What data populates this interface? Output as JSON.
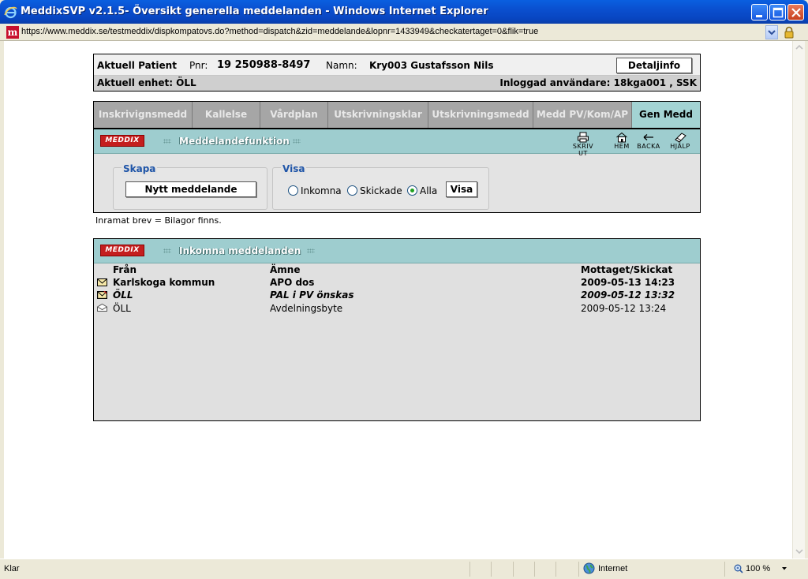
{
  "window": {
    "title": "MeddixSVP v2.1.5- Översikt generella meddelanden - Windows Internet Explorer",
    "url": "https://www.meddix.se/testmeddix/dispkompatovs.do?method=dispatch&zid=meddelande&lopnr=1433949&checkatertaget=0&flik=true"
  },
  "patient": {
    "heading": "Aktuell Patient",
    "pnr_label": "Pnr:",
    "pnr_value": "19 250988-8497",
    "name_label": "Namn:",
    "name_value": "Kry003 Gustafsson Nils",
    "detail_button": "Detaljinfo",
    "unit_text": "Aktuell enhet: ÖLL",
    "user_text": "Inloggad användare: 18kga001 , SSK"
  },
  "tabs": [
    {
      "label": "Inskrivignsmedd"
    },
    {
      "label": "Kallelse"
    },
    {
      "label": "Vårdplan"
    },
    {
      "label": "Utskrivningsklar"
    },
    {
      "label": "Utskrivningsmedd"
    },
    {
      "label": "Medd PV/Kom/AP"
    },
    {
      "label": "Gen Medd"
    }
  ],
  "function_panel": {
    "logo": "MEDDIX",
    "title": "Meddelandefunktion",
    "tools": {
      "print": "SKRIV UT",
      "home": "HEM",
      "back": "BACKA",
      "help": "HJÄLP"
    },
    "create": {
      "legend": "Skapa",
      "button": "Nytt meddelande"
    },
    "show": {
      "legend": "Visa",
      "options": [
        "Inkomna",
        "Skickade",
        "Alla"
      ],
      "selected": "Alla",
      "button": "Visa"
    }
  },
  "note": "Inramat brev = Bilagor finns.",
  "messages_panel": {
    "logo": "MEDDIX",
    "title": "Inkomna meddelanden",
    "headers": {
      "from": "Från",
      "subject": "Ämne",
      "date": "Mottaget/Skickat"
    },
    "rows": [
      {
        "from": "Karlskoga kommun",
        "subject": "APO dos",
        "date": "2009-05-13 14:23",
        "style": "bold",
        "icon": "envelope-icon"
      },
      {
        "from": "ÖLL",
        "subject": "PAL i PV önskas",
        "date": "2009-05-12 13:32",
        "style": "bold-italic",
        "icon": "envelope-attachment-icon"
      },
      {
        "from": "ÖLL",
        "subject": "Avdelningsbyte",
        "date": "2009-05-12 13:24",
        "style": "normal",
        "icon": "open-envelope-icon"
      }
    ]
  },
  "status": {
    "left": "Klar",
    "zone": "Internet",
    "zoom": "100 %"
  },
  "colors": {
    "panel_header": "#9ecdcf",
    "active_tab": "#a3d3d3",
    "legend_blue": "#1f55a8",
    "meddix_red": "#c41e1e"
  }
}
